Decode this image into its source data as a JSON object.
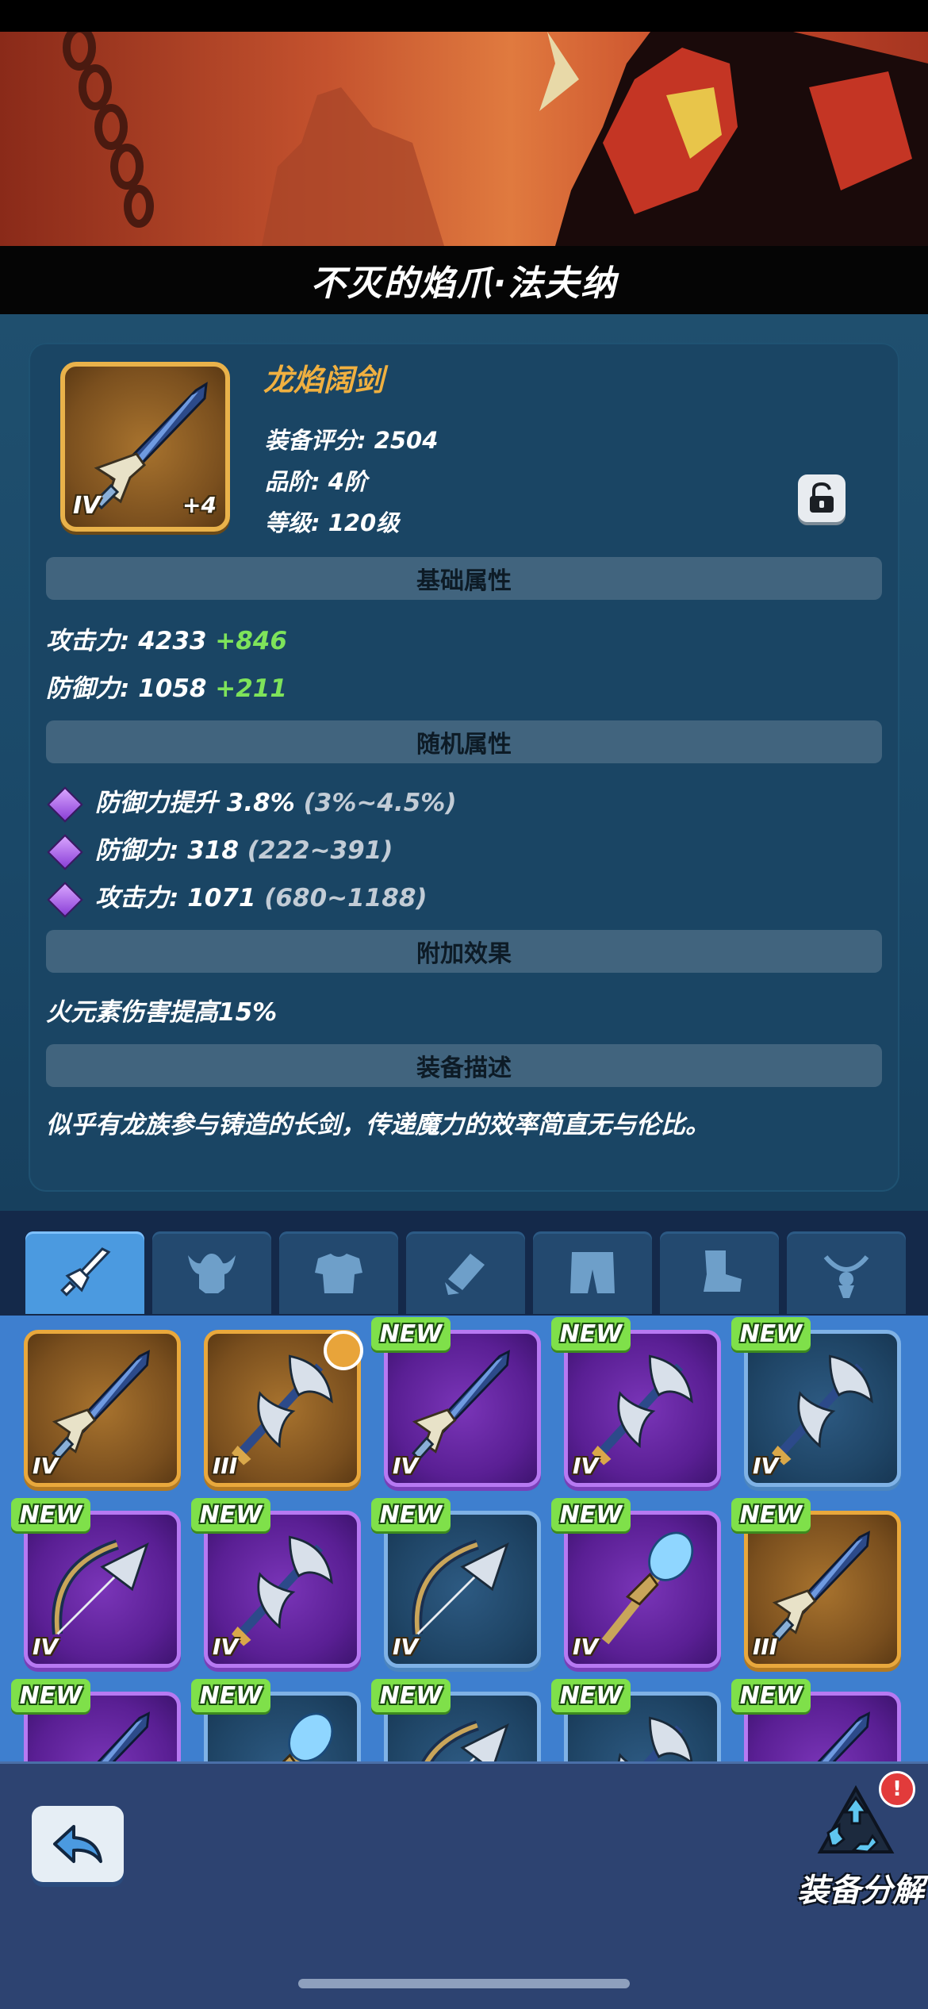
{
  "hero": {
    "title": "不灭的焰爪·法夫纳"
  },
  "item": {
    "name": "龙焰阔剑",
    "tier_roman": "IV",
    "plus_level": "+4",
    "score": "装备评分: 2504",
    "rank": "品阶: 4阶",
    "level": "等级: 120级"
  },
  "sections": {
    "base": "基础属性",
    "random": "随机属性",
    "extra": "附加效果",
    "desc": "装备描述"
  },
  "base_stats": [
    {
      "label": "攻击力: 4233",
      "bonus": "+846"
    },
    {
      "label": "防御力: 1058",
      "bonus": "+211"
    }
  ],
  "random_stats": [
    {
      "label": "防御力提升 3.8%",
      "range": "(3%~4.5%)"
    },
    {
      "label": "防御力: 318",
      "range": "(222~391)"
    },
    {
      "label": "攻击力: 1071",
      "range": "(680~1188)"
    }
  ],
  "extra_effect": "火元素伤害提高15%",
  "description": "似乎有龙族参与铸造的长剑，传递魔力的效率简直无与伦比。",
  "tabs": [
    "sword-icon",
    "helmet-icon",
    "armor-icon",
    "bracer-icon",
    "pants-icon",
    "boots-icon",
    "necklace-icon"
  ],
  "inventory": [
    {
      "weapon": "sword",
      "rarity": "gold",
      "tier": "IV",
      "new": false
    },
    {
      "weapon": "axe",
      "rarity": "gold",
      "tier": "III",
      "new": false,
      "equipped": true
    },
    {
      "weapon": "sword",
      "rarity": "purple",
      "tier": "IV",
      "new": true
    },
    {
      "weapon": "axe",
      "rarity": "purple",
      "tier": "IV",
      "new": true
    },
    {
      "weapon": "axe",
      "rarity": "blue",
      "tier": "IV",
      "new": true
    },
    {
      "weapon": "bow",
      "rarity": "purple",
      "tier": "IV",
      "new": true
    },
    {
      "weapon": "axe",
      "rarity": "purple",
      "tier": "IV",
      "new": true
    },
    {
      "weapon": "bow",
      "rarity": "blue",
      "tier": "IV",
      "new": true
    },
    {
      "weapon": "staff",
      "rarity": "purple",
      "tier": "IV",
      "new": true
    },
    {
      "weapon": "sword",
      "rarity": "gold",
      "tier": "III",
      "new": true
    },
    {
      "weapon": "sword",
      "rarity": "purple",
      "tier": "",
      "new": true
    },
    {
      "weapon": "staff",
      "rarity": "blue",
      "tier": "",
      "new": true
    },
    {
      "weapon": "bow",
      "rarity": "blue",
      "tier": "",
      "new": true
    },
    {
      "weapon": "axe",
      "rarity": "blue",
      "tier": "",
      "new": true
    },
    {
      "weapon": "sword",
      "rarity": "purple",
      "tier": "",
      "new": true
    }
  ],
  "new_label": "NEW",
  "bottom": {
    "recycle_label": "装备分解",
    "notif": "!"
  },
  "colors": {
    "gold": "#e9a83c",
    "purple": "#b779f2",
    "blue": "#7fb2e6",
    "new": "#7fe04a",
    "title": "#f0b040"
  }
}
